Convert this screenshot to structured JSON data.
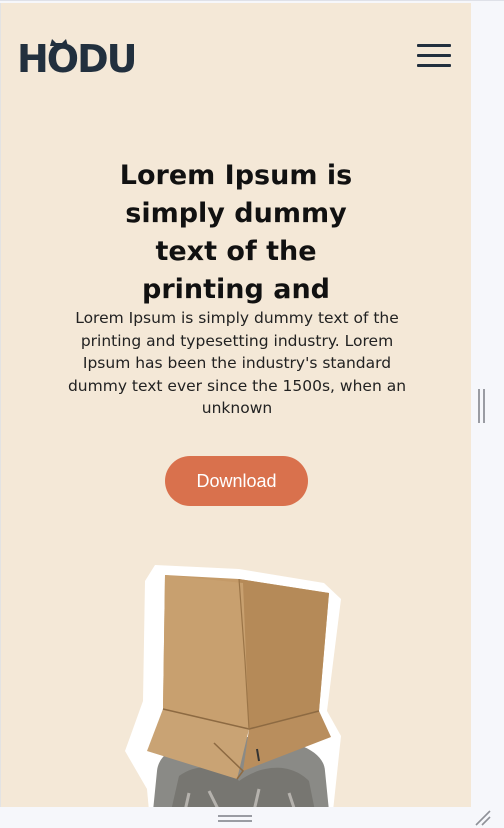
{
  "header": {
    "logo_text": "HODU",
    "menu_icon": "hamburger-menu-icon"
  },
  "hero": {
    "title": "Lorem Ipsum is simply dummy text of the printing and",
    "description": "Lorem Ipsum is simply dummy text of the printing and typesetting industry. Lorem Ipsum has been the industry's standard dummy text ever since the 1500s, when an unknown",
    "download_label": "Download"
  },
  "illustration": {
    "icon": "cat-in-box-illustration"
  },
  "colors": {
    "page_background": "#f4e8d7",
    "accent": "#d9714d",
    "logo": "#22303e"
  }
}
